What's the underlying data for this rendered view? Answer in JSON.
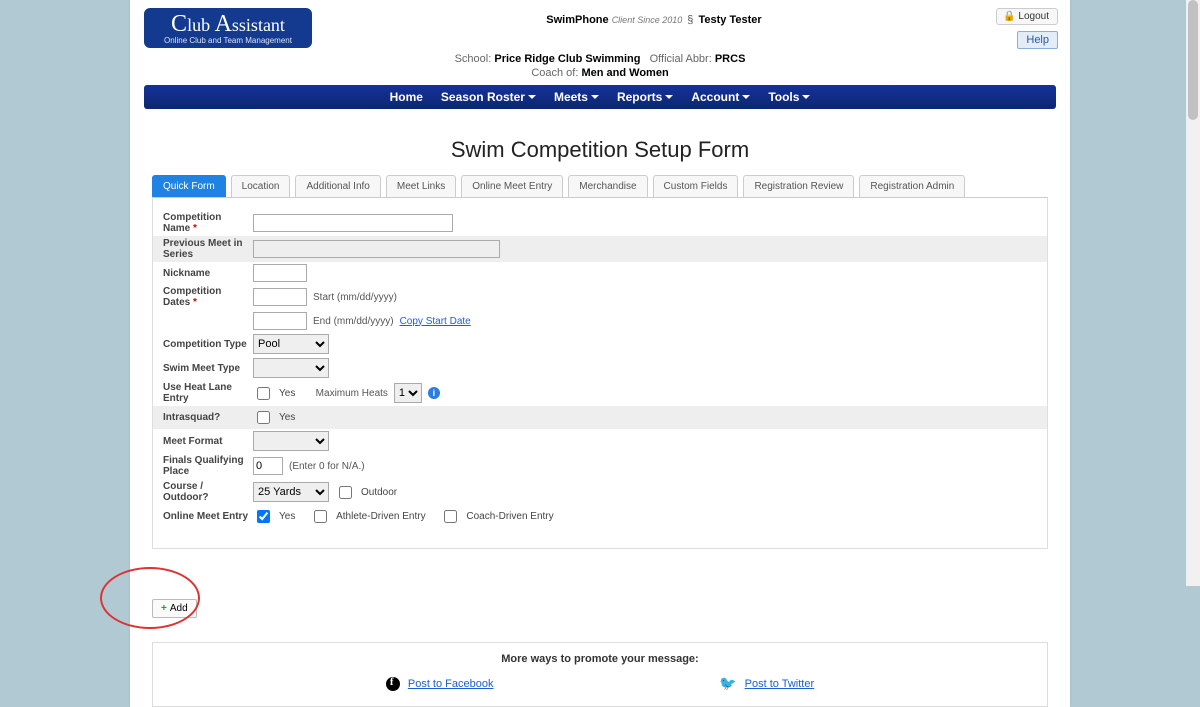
{
  "header": {
    "logo_main": "Club Assistant",
    "logo_sub": "Online Club and Team Management",
    "swimphone": "SwimPhone",
    "client_since": "Client Since 2010",
    "section_mark": "§",
    "user_name": "Testy Tester",
    "logout": "Logout",
    "help": "Help",
    "school_prefix": "School:",
    "school_name": "Price Ridge Club Swimming",
    "abbr_prefix": "Official Abbr:",
    "abbr_value": "PRCS",
    "coach_prefix": "Coach of:",
    "coach_value": "Men and Women"
  },
  "nav": {
    "home": "Home",
    "roster": "Season Roster",
    "meets": "Meets",
    "reports": "Reports",
    "account": "Account",
    "tools": "Tools"
  },
  "page_title": "Swim Competition Setup Form",
  "tabs": {
    "quick": "Quick Form",
    "location": "Location",
    "additional": "Additional Info",
    "meetlinks": "Meet Links",
    "onlinemeet": "Online Meet Entry",
    "merch": "Merchandise",
    "custom": "Custom Fields",
    "regreview": "Registration Review",
    "regadmin": "Registration Admin"
  },
  "form": {
    "comp_name": {
      "label": "Competition Name",
      "value": ""
    },
    "prev_meet": {
      "label": "Previous Meet in Series",
      "value": ""
    },
    "nickname": {
      "label": "Nickname",
      "value": ""
    },
    "dates": {
      "label": "Competition Dates",
      "start_value": "",
      "start_hint": "Start (mm/dd/yyyy)",
      "end_value": "",
      "end_hint": "End (mm/dd/yyyy)",
      "copy_link": "Copy Start Date"
    },
    "comp_type": {
      "label": "Competition Type",
      "value": "Pool"
    },
    "swim_meet_type": {
      "label": "Swim Meet Type",
      "value": ""
    },
    "heat_lane": {
      "label": "Use Heat Lane Entry",
      "yes": "Yes",
      "max_label": "Maximum Heats",
      "max_value": "1"
    },
    "intrasquad": {
      "label": "Intrasquad?",
      "yes": "Yes"
    },
    "meet_format": {
      "label": "Meet Format",
      "value": ""
    },
    "finals": {
      "label": "Finals Qualifying Place",
      "value": "0",
      "hint": "(Enter 0 for N/A.)"
    },
    "course": {
      "label": "Course / Outdoor?",
      "value": "25 Yards",
      "outdoor": "Outdoor"
    },
    "ome": {
      "label": "Online Meet Entry",
      "yes": "Yes",
      "athlete": "Athlete-Driven Entry",
      "coach": "Coach-Driven Entry"
    }
  },
  "add_button": "Add",
  "promote": {
    "title": "More ways to promote your message:",
    "fb": "Post to Facebook",
    "tw": "Post to Twitter"
  }
}
